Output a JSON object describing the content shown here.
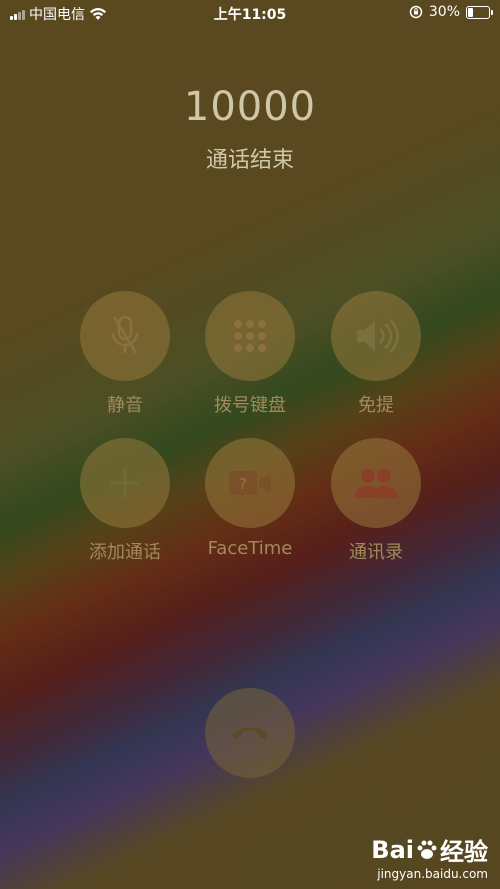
{
  "status_bar": {
    "carrier": "中国电信",
    "time": "上午11:05",
    "battery_percent": "30%",
    "battery_level": 0.3,
    "wifi_icon": "wifi-icon",
    "orientation_lock_icon": "orientation-lock-icon"
  },
  "call": {
    "number": "10000",
    "status": "通话结束"
  },
  "buttons": [
    {
      "label": "静音",
      "icon": "mute-microphone-icon"
    },
    {
      "label": "拨号键盘",
      "icon": "keypad-icon"
    },
    {
      "label": "免提",
      "icon": "speaker-icon"
    },
    {
      "label": "添加通话",
      "icon": "plus-icon"
    },
    {
      "label": "FaceTime",
      "icon": "facetime-camera-icon"
    },
    {
      "label": "通讯录",
      "icon": "contacts-icon"
    }
  ],
  "end_call": {
    "icon": "end-call-phone-icon"
  },
  "watermark": {
    "brand": "Bai",
    "brand_suffix": "经验",
    "url": "jingyan.baidu.com"
  }
}
